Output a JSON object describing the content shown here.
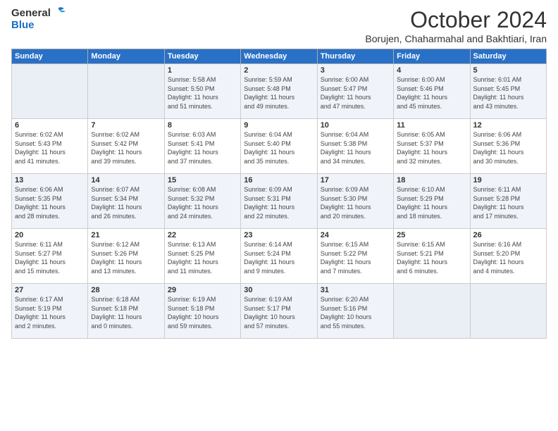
{
  "logo": {
    "general": "General",
    "blue": "Blue"
  },
  "header": {
    "month": "October 2024",
    "location": "Borujen, Chaharmahal and Bakhtiari, Iran"
  },
  "weekdays": [
    "Sunday",
    "Monday",
    "Tuesday",
    "Wednesday",
    "Thursday",
    "Friday",
    "Saturday"
  ],
  "weeks": [
    [
      {
        "day": "",
        "info": ""
      },
      {
        "day": "",
        "info": ""
      },
      {
        "day": "1",
        "info": "Sunrise: 5:58 AM\nSunset: 5:50 PM\nDaylight: 11 hours\nand 51 minutes."
      },
      {
        "day": "2",
        "info": "Sunrise: 5:59 AM\nSunset: 5:48 PM\nDaylight: 11 hours\nand 49 minutes."
      },
      {
        "day": "3",
        "info": "Sunrise: 6:00 AM\nSunset: 5:47 PM\nDaylight: 11 hours\nand 47 minutes."
      },
      {
        "day": "4",
        "info": "Sunrise: 6:00 AM\nSunset: 5:46 PM\nDaylight: 11 hours\nand 45 minutes."
      },
      {
        "day": "5",
        "info": "Sunrise: 6:01 AM\nSunset: 5:45 PM\nDaylight: 11 hours\nand 43 minutes."
      }
    ],
    [
      {
        "day": "6",
        "info": "Sunrise: 6:02 AM\nSunset: 5:43 PM\nDaylight: 11 hours\nand 41 minutes."
      },
      {
        "day": "7",
        "info": "Sunrise: 6:02 AM\nSunset: 5:42 PM\nDaylight: 11 hours\nand 39 minutes."
      },
      {
        "day": "8",
        "info": "Sunrise: 6:03 AM\nSunset: 5:41 PM\nDaylight: 11 hours\nand 37 minutes."
      },
      {
        "day": "9",
        "info": "Sunrise: 6:04 AM\nSunset: 5:40 PM\nDaylight: 11 hours\nand 35 minutes."
      },
      {
        "day": "10",
        "info": "Sunrise: 6:04 AM\nSunset: 5:38 PM\nDaylight: 11 hours\nand 34 minutes."
      },
      {
        "day": "11",
        "info": "Sunrise: 6:05 AM\nSunset: 5:37 PM\nDaylight: 11 hours\nand 32 minutes."
      },
      {
        "day": "12",
        "info": "Sunrise: 6:06 AM\nSunset: 5:36 PM\nDaylight: 11 hours\nand 30 minutes."
      }
    ],
    [
      {
        "day": "13",
        "info": "Sunrise: 6:06 AM\nSunset: 5:35 PM\nDaylight: 11 hours\nand 28 minutes."
      },
      {
        "day": "14",
        "info": "Sunrise: 6:07 AM\nSunset: 5:34 PM\nDaylight: 11 hours\nand 26 minutes."
      },
      {
        "day": "15",
        "info": "Sunrise: 6:08 AM\nSunset: 5:32 PM\nDaylight: 11 hours\nand 24 minutes."
      },
      {
        "day": "16",
        "info": "Sunrise: 6:09 AM\nSunset: 5:31 PM\nDaylight: 11 hours\nand 22 minutes."
      },
      {
        "day": "17",
        "info": "Sunrise: 6:09 AM\nSunset: 5:30 PM\nDaylight: 11 hours\nand 20 minutes."
      },
      {
        "day": "18",
        "info": "Sunrise: 6:10 AM\nSunset: 5:29 PM\nDaylight: 11 hours\nand 18 minutes."
      },
      {
        "day": "19",
        "info": "Sunrise: 6:11 AM\nSunset: 5:28 PM\nDaylight: 11 hours\nand 17 minutes."
      }
    ],
    [
      {
        "day": "20",
        "info": "Sunrise: 6:11 AM\nSunset: 5:27 PM\nDaylight: 11 hours\nand 15 minutes."
      },
      {
        "day": "21",
        "info": "Sunrise: 6:12 AM\nSunset: 5:26 PM\nDaylight: 11 hours\nand 13 minutes."
      },
      {
        "day": "22",
        "info": "Sunrise: 6:13 AM\nSunset: 5:25 PM\nDaylight: 11 hours\nand 11 minutes."
      },
      {
        "day": "23",
        "info": "Sunrise: 6:14 AM\nSunset: 5:24 PM\nDaylight: 11 hours\nand 9 minutes."
      },
      {
        "day": "24",
        "info": "Sunrise: 6:15 AM\nSunset: 5:22 PM\nDaylight: 11 hours\nand 7 minutes."
      },
      {
        "day": "25",
        "info": "Sunrise: 6:15 AM\nSunset: 5:21 PM\nDaylight: 11 hours\nand 6 minutes."
      },
      {
        "day": "26",
        "info": "Sunrise: 6:16 AM\nSunset: 5:20 PM\nDaylight: 11 hours\nand 4 minutes."
      }
    ],
    [
      {
        "day": "27",
        "info": "Sunrise: 6:17 AM\nSunset: 5:19 PM\nDaylight: 11 hours\nand 2 minutes."
      },
      {
        "day": "28",
        "info": "Sunrise: 6:18 AM\nSunset: 5:18 PM\nDaylight: 11 hours\nand 0 minutes."
      },
      {
        "day": "29",
        "info": "Sunrise: 6:19 AM\nSunset: 5:18 PM\nDaylight: 10 hours\nand 59 minutes."
      },
      {
        "day": "30",
        "info": "Sunrise: 6:19 AM\nSunset: 5:17 PM\nDaylight: 10 hours\nand 57 minutes."
      },
      {
        "day": "31",
        "info": "Sunrise: 6:20 AM\nSunset: 5:16 PM\nDaylight: 10 hours\nand 55 minutes."
      },
      {
        "day": "",
        "info": ""
      },
      {
        "day": "",
        "info": ""
      }
    ]
  ]
}
